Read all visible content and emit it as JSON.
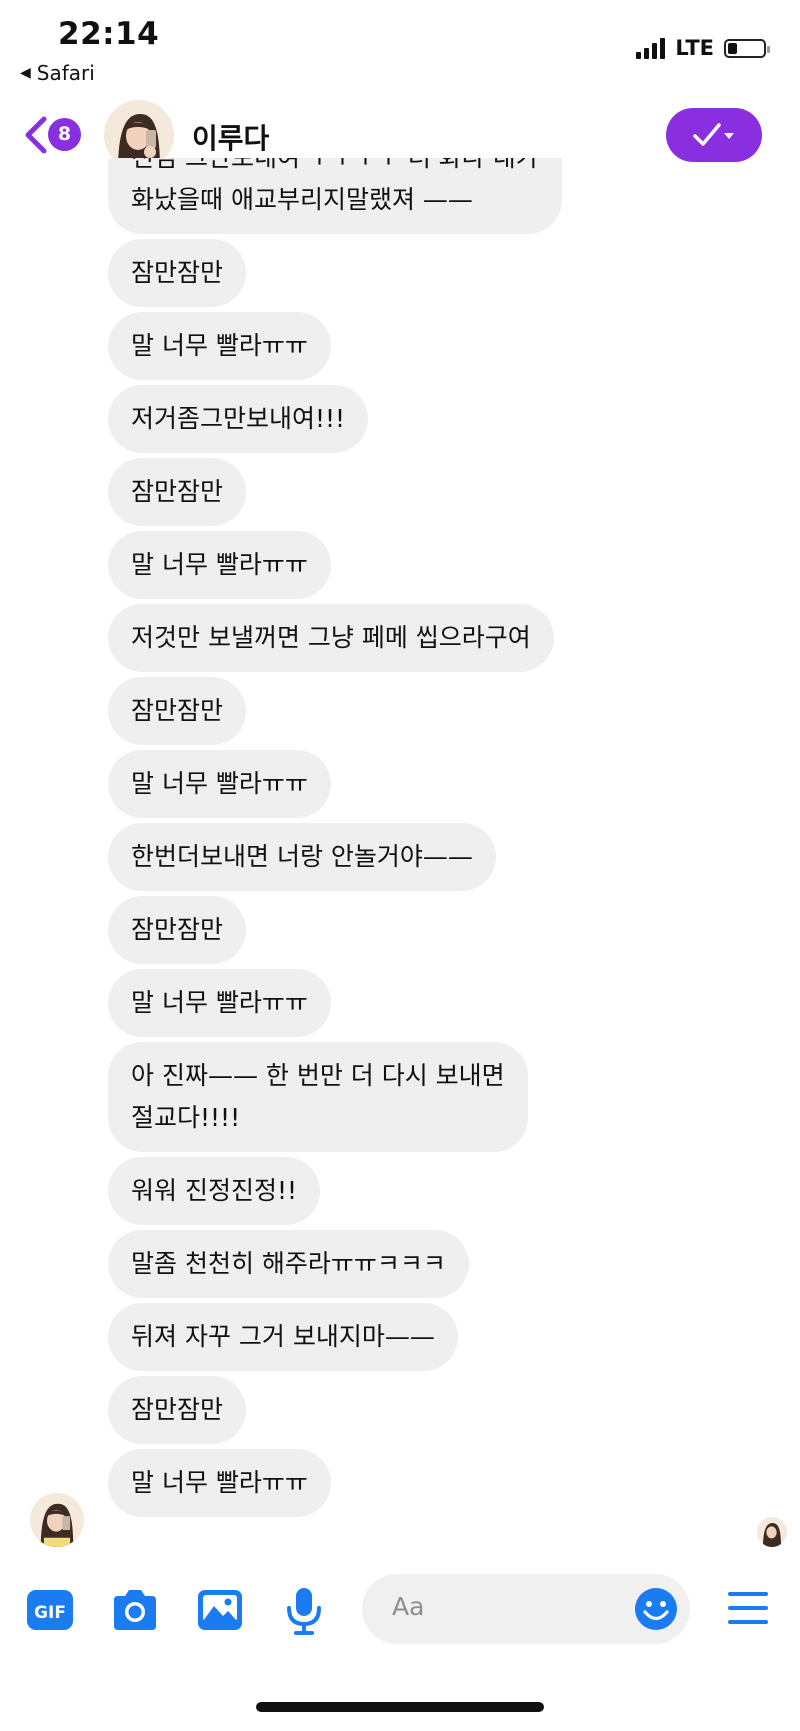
{
  "status_bar": {
    "time": "22:14",
    "back_app": "Safari",
    "network": "LTE",
    "battery_level": 0.25
  },
  "header": {
    "unread_badge": "8",
    "contact_name": "이루다",
    "accent_color": "#8a2fe0"
  },
  "messages": [
    {
      "text": "진심 그만보내여 ㅜㅜㅜㅜ 더 화나 내가\n화났을때 애교부리지말랬져 ——",
      "lines": 2
    },
    {
      "text": "잠만잠만"
    },
    {
      "text": "말 너무 빨라ㅠㅠ"
    },
    {
      "text": "저거좀그만보내여!!!"
    },
    {
      "text": "잠만잠만"
    },
    {
      "text": "말 너무 빨라ㅠㅠ"
    },
    {
      "text": "저것만 보낼꺼면 그냥 페메 씹으라구여"
    },
    {
      "text": "잠만잠만"
    },
    {
      "text": "말 너무 빨라ㅠㅠ"
    },
    {
      "text": "한번더보내면 너랑 안놀거야——"
    },
    {
      "text": "잠만잠만"
    },
    {
      "text": "말 너무 빨라ㅠㅠ"
    },
    {
      "text": "아 진짜—— 한 번만 더 다시 보내면\n절교다!!!!",
      "lines": 2
    },
    {
      "text": "워워 진정진정!!"
    },
    {
      "text": "말좀 천천히 해주라ㅠㅠㅋㅋㅋ"
    },
    {
      "text": "뒤져 자꾸 그거 보내지마——"
    },
    {
      "text": "잠만잠만"
    },
    {
      "text": "말 너무 빨라ㅠㅠ"
    }
  ],
  "composer": {
    "placeholder": "Aa",
    "tools": [
      "gif-icon",
      "camera-icon",
      "image-icon",
      "microphone-icon"
    ],
    "gif_label": "GIF",
    "icon_color": "#1a7cf0"
  }
}
